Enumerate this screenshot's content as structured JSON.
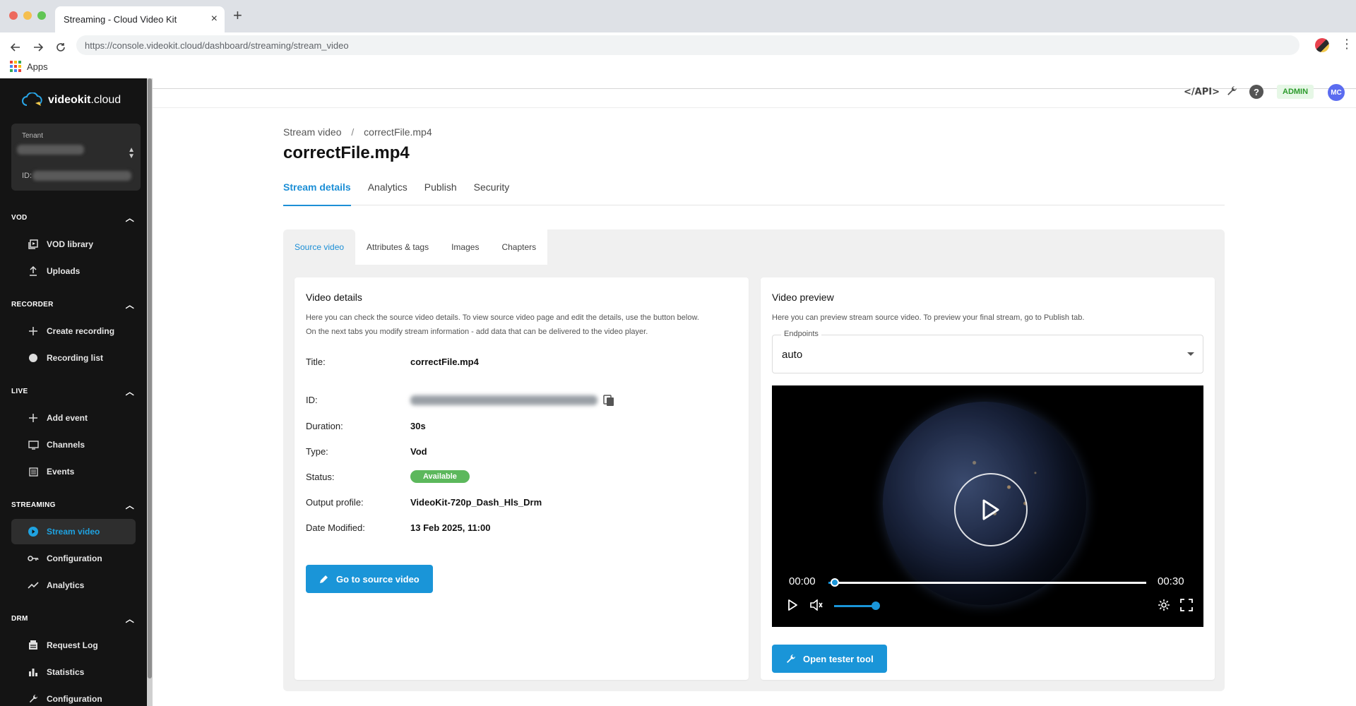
{
  "browser": {
    "tab_title": "Streaming - Cloud Video Kit",
    "tab_close": "×",
    "new_tab": "+",
    "url": "https://console.videokit.cloud/dashboard/streaming/stream_video",
    "bookmark_apps": "Apps"
  },
  "sidebar": {
    "logo_bold": "videokit",
    "logo_rest": ".cloud",
    "tenant_label": "Tenant",
    "tenant_id_label": "ID:",
    "sections": [
      {
        "title": "VOD",
        "items": [
          {
            "label": "VOD library",
            "icon": "library-icon"
          },
          {
            "label": "Uploads",
            "icon": "upload-icon"
          }
        ]
      },
      {
        "title": "RECORDER",
        "items": [
          {
            "label": "Create recording",
            "icon": "plus-icon"
          },
          {
            "label": "Recording list",
            "icon": "record-icon"
          }
        ]
      },
      {
        "title": "LIVE",
        "items": [
          {
            "label": "Add event",
            "icon": "plus-icon"
          },
          {
            "label": "Channels",
            "icon": "monitor-icon"
          },
          {
            "label": "Events",
            "icon": "list-icon"
          }
        ]
      },
      {
        "title": "STREAMING",
        "items": [
          {
            "label": "Stream video",
            "icon": "play-circle-icon",
            "active": true
          },
          {
            "label": "Configuration",
            "icon": "key-icon"
          },
          {
            "label": "Analytics",
            "icon": "trend-icon"
          }
        ]
      },
      {
        "title": "DRM",
        "items": [
          {
            "label": "Request Log",
            "icon": "log-icon"
          },
          {
            "label": "Statistics",
            "icon": "bar-chart-icon"
          },
          {
            "label": "Configuration",
            "icon": "wrench-icon"
          }
        ]
      }
    ]
  },
  "appbar": {
    "api_label": "</API>",
    "admin_label": "ADMIN",
    "avatar_initials": "MC"
  },
  "page": {
    "breadcrumb_parent": "Stream video",
    "breadcrumb_sep": "/",
    "breadcrumb_current": "correctFile.mp4",
    "title": "correctFile.mp4",
    "main_tabs": [
      "Stream details",
      "Analytics",
      "Publish",
      "Security"
    ],
    "active_main_tab": "Stream details",
    "sub_tabs": [
      "Source video",
      "Attributes & tags",
      "Images",
      "Chapters"
    ],
    "active_sub_tab": "Source video"
  },
  "video_details": {
    "heading": "Video details",
    "description_line1": "Here you can check the source video details. To view source video page and edit the details, use the button below.",
    "description_line2": "On the next tabs you modify stream information - add data that can be delivered to the video player.",
    "rows": [
      {
        "label": "Title:",
        "value": "correctFile.mp4"
      },
      {
        "label": "ID:",
        "value": ""
      },
      {
        "label": "Duration:",
        "value": "30s"
      },
      {
        "label": "Type:",
        "value": "Vod"
      },
      {
        "label": "Status:",
        "value": "Available"
      },
      {
        "label": "Output profile:",
        "value": "VideoKit-720p_Dash_Hls_Drm"
      },
      {
        "label": "Date Modified:",
        "value": "13 Feb 2025, 11:00"
      }
    ],
    "button_label": "Go to source video"
  },
  "video_preview": {
    "heading": "Video preview",
    "description": "Here you can preview stream source video. To preview your final stream, go to Publish tab.",
    "endpoints_label": "Endpoints",
    "endpoints_value": "auto",
    "player": {
      "current_time": "00:00",
      "duration": "00:30",
      "progress_fraction": 0.02,
      "volume_fraction": 1.0
    },
    "button_label": "Open tester tool"
  },
  "colors": {
    "accent": "#1a95d8",
    "sidebar_bg": "#141414",
    "status_available": "#5cb85c",
    "admin_badge_text": "#2b9a2b",
    "avatar_bg": "#5b6cf0"
  }
}
